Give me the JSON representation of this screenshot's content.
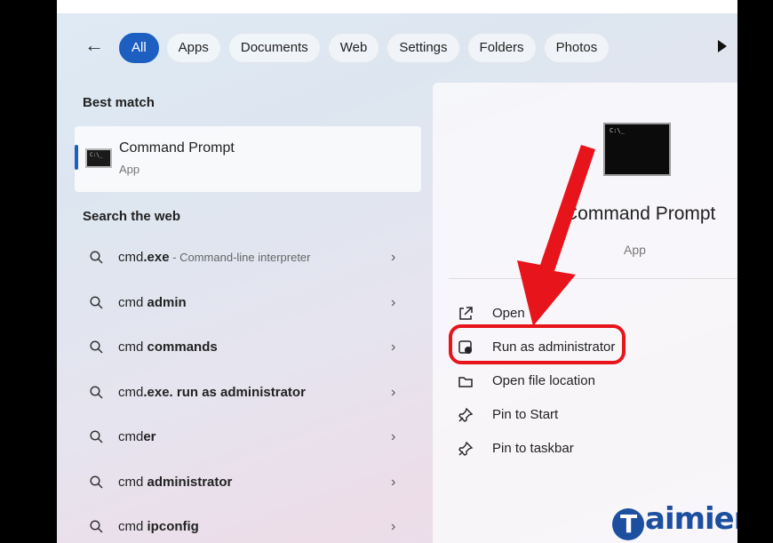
{
  "filters": {
    "back_label": "←",
    "chips": [
      "All",
      "Apps",
      "Documents",
      "Web",
      "Settings",
      "Folders",
      "Photos"
    ],
    "active": "All"
  },
  "best_match": {
    "heading": "Best match",
    "title": "Command Prompt",
    "subtitle": "App"
  },
  "web": {
    "heading": "Search the web",
    "items": [
      {
        "prefix": "cmd",
        "bold": ".exe",
        "desc": " - Command-line interpreter"
      },
      {
        "prefix": "cmd ",
        "bold": "admin",
        "desc": ""
      },
      {
        "prefix": "cmd ",
        "bold": "commands",
        "desc": ""
      },
      {
        "prefix": "cmd",
        "bold": ".exe. run as administrator",
        "desc": ""
      },
      {
        "prefix": "cmd",
        "bold": "er",
        "desc": ""
      },
      {
        "prefix": "cmd ",
        "bold": "administrator",
        "desc": ""
      },
      {
        "prefix": "cmd ",
        "bold": "ipconfig",
        "desc": ""
      }
    ]
  },
  "details": {
    "title": "Command Prompt",
    "subtitle": "App",
    "actions": [
      "Open",
      "Run as administrator",
      "Open file location",
      "Pin to Start",
      "Pin to taskbar"
    ]
  },
  "watermark": {
    "letter": "T",
    "text": "aimienphi"
  },
  "colors": {
    "accent": "#1d5fc0",
    "annotation": "#e8141b"
  }
}
